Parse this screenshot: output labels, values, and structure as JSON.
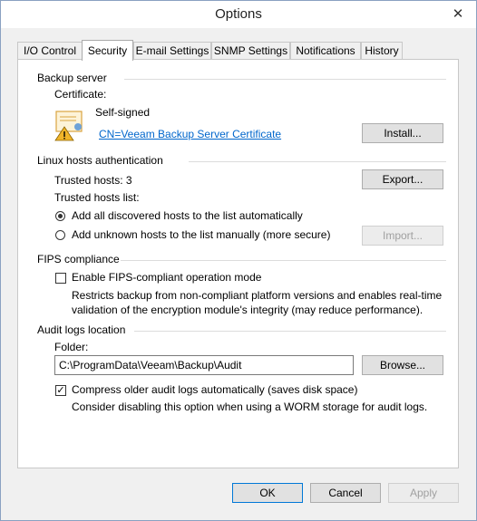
{
  "window": {
    "title": "Options",
    "close_glyph": "✕"
  },
  "tabs": [
    {
      "label": "I/O Control",
      "active": false
    },
    {
      "label": "Security",
      "active": true
    },
    {
      "label": "E-mail Settings",
      "active": false
    },
    {
      "label": "SNMP Settings",
      "active": false
    },
    {
      "label": "Notifications",
      "active": false
    },
    {
      "label": "History",
      "active": false
    }
  ],
  "backup_server": {
    "title": "Backup server",
    "certificate_label": "Certificate:",
    "certificate_status": "Self-signed",
    "certificate_link": "CN=Veeam Backup Server Certificate",
    "certificate_icon": "certificate-warning-icon",
    "install_button": "Install..."
  },
  "linux_hosts": {
    "title": "Linux hosts authentication",
    "trusted_hosts": "Trusted hosts: 3",
    "trusted_hosts_list_label": "Trusted hosts list:",
    "export_button": "Export...",
    "import_button": "Import...",
    "option_auto": "Add all discovered hosts to the list automatically",
    "option_manual": "Add unknown hosts to the list manually (more secure)",
    "selected_option": "auto"
  },
  "fips": {
    "title": "FIPS compliance",
    "checkbox_label": "Enable FIPS-compliant operation mode",
    "checked": false,
    "description_line1": "Restricts backup from non-compliant platform versions and enables real-time",
    "description_line2": "validation of the encryption module's integrity (may reduce performance)."
  },
  "audit_logs": {
    "title": "Audit logs location",
    "folder_label": "Folder:",
    "folder_value": "C:\\ProgramData\\Veeam\\Backup\\Audit",
    "browse_button": "Browse...",
    "compress_label": "Compress older audit logs automatically (saves disk space)",
    "compress_checked": true,
    "compress_description": "Consider disabling this option when using a WORM storage for audit logs."
  },
  "footer": {
    "ok": "OK",
    "cancel": "Cancel",
    "apply": "Apply"
  },
  "colors": {
    "accent": "#0078d7",
    "link": "#0066cc",
    "warning": "#f0b429"
  }
}
